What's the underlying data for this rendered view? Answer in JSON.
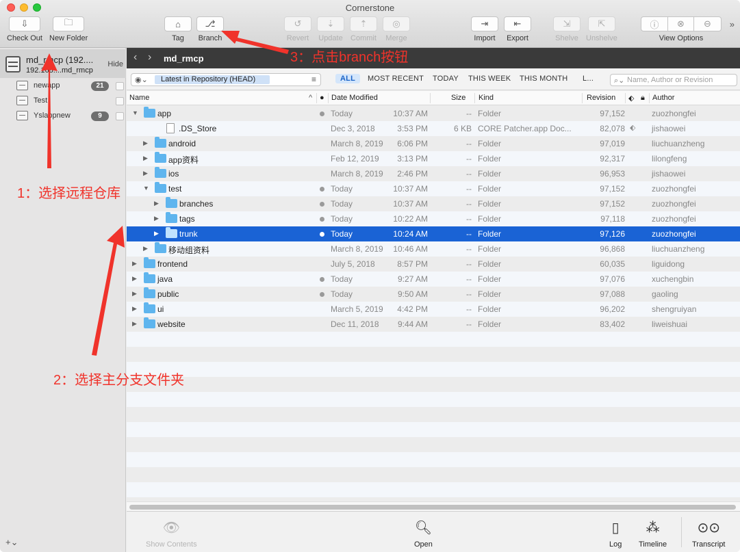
{
  "window": {
    "title": "Cornerstone"
  },
  "toolbar": {
    "check_out": "Check Out",
    "new_folder": "New Folder",
    "tag": "Tag",
    "branch": "Branch",
    "revert": "Revert",
    "update": "Update",
    "commit": "Commit",
    "merge": "Merge",
    "import": "Import",
    "export": "Export",
    "shelve": "Shelve",
    "unshelve": "Unshelve",
    "view_options": "View Options",
    "more": "»"
  },
  "sidebar": {
    "repo": {
      "name": "md_rmcp (192....",
      "host": "192.168....md_rmcp",
      "hide": "Hide"
    },
    "items": [
      {
        "label": "newapp",
        "badge": "21"
      },
      {
        "label": "Test",
        "badge": ""
      },
      {
        "label": "Yslappnew",
        "badge": "9"
      }
    ],
    "add": "+⌄"
  },
  "nav": {
    "back": "‹",
    "forward": "›",
    "title": "md_rmcp"
  },
  "filter": {
    "scope_icon": "eye-icon",
    "scope": "Latest in Repository (HEAD)",
    "tabs": [
      "ALL",
      "MOST RECENT",
      "TODAY",
      "THIS WEEK",
      "THIS MONTH",
      "L..."
    ],
    "active_tab": "ALL",
    "search_placeholder": "Name, Author or Revision"
  },
  "columns": {
    "name": "Name",
    "date_modified": "Date Modified",
    "size": "Size",
    "kind": "Kind",
    "revision": "Revision",
    "author": "Author"
  },
  "rows": [
    {
      "name": "app",
      "disclosure": "▼",
      "indent": 0,
      "type": "folder",
      "dot": true,
      "date": "Today",
      "time": "10:37 AM",
      "size": "--",
      "kind": "Folder",
      "revision": "97,152",
      "author": "zuozhongfei",
      "tag": false,
      "selected": false
    },
    {
      "name": ".DS_Store",
      "disclosure": "",
      "indent": 1,
      "type": "file",
      "dot": false,
      "date": "Dec 3, 2018",
      "time": "3:53 PM",
      "size": "6 KB",
      "kind": "CORE Patcher.app Doc...",
      "revision": "82,078",
      "author": "jishaowei",
      "tag": true,
      "selected": false
    },
    {
      "name": "android",
      "disclosure": "▶",
      "indent": 1,
      "type": "folder",
      "dot": false,
      "date": "March 8, 2019",
      "time": "6:06 PM",
      "size": "--",
      "kind": "Folder",
      "revision": "97,019",
      "author": "liuchuanzheng",
      "tag": false,
      "selected": false
    },
    {
      "name": "app资料",
      "disclosure": "▶",
      "indent": 1,
      "type": "folder",
      "dot": false,
      "date": "Feb 12, 2019",
      "time": "3:13 PM",
      "size": "--",
      "kind": "Folder",
      "revision": "92,317",
      "author": "lilongfeng",
      "tag": false,
      "selected": false
    },
    {
      "name": "ios",
      "disclosure": "▶",
      "indent": 1,
      "type": "folder",
      "dot": false,
      "date": "March 8, 2019",
      "time": "2:46 PM",
      "size": "--",
      "kind": "Folder",
      "revision": "96,953",
      "author": "jishaowei",
      "tag": false,
      "selected": false
    },
    {
      "name": "test",
      "disclosure": "▼",
      "indent": 1,
      "type": "folder",
      "dot": true,
      "date": "Today",
      "time": "10:37 AM",
      "size": "--",
      "kind": "Folder",
      "revision": "97,152",
      "author": "zuozhongfei",
      "tag": false,
      "selected": false
    },
    {
      "name": "branches",
      "disclosure": "▶",
      "indent": 2,
      "type": "folder",
      "dot": true,
      "date": "Today",
      "time": "10:37 AM",
      "size": "--",
      "kind": "Folder",
      "revision": "97,152",
      "author": "zuozhongfei",
      "tag": false,
      "selected": false
    },
    {
      "name": "tags",
      "disclosure": "▶",
      "indent": 2,
      "type": "folder",
      "dot": true,
      "date": "Today",
      "time": "10:22 AM",
      "size": "--",
      "kind": "Folder",
      "revision": "97,118",
      "author": "zuozhongfei",
      "tag": false,
      "selected": false
    },
    {
      "name": "trunk",
      "disclosure": "▶",
      "indent": 2,
      "type": "folder",
      "dot": true,
      "date": "Today",
      "time": "10:24 AM",
      "size": "--",
      "kind": "Folder",
      "revision": "97,126",
      "author": "zuozhongfei",
      "tag": false,
      "selected": true
    },
    {
      "name": "移动组资料",
      "disclosure": "▶",
      "indent": 1,
      "type": "folder",
      "dot": false,
      "date": "March 8, 2019",
      "time": "10:46 AM",
      "size": "--",
      "kind": "Folder",
      "revision": "96,868",
      "author": "liuchuanzheng",
      "tag": false,
      "selected": false
    },
    {
      "name": "frontend",
      "disclosure": "▶",
      "indent": 0,
      "type": "folder",
      "dot": false,
      "date": "July 5, 2018",
      "time": "8:57 PM",
      "size": "--",
      "kind": "Folder",
      "revision": "60,035",
      "author": "liguidong",
      "tag": false,
      "selected": false
    },
    {
      "name": "java",
      "disclosure": "▶",
      "indent": 0,
      "type": "folder",
      "dot": true,
      "date": "Today",
      "time": "9:27 AM",
      "size": "--",
      "kind": "Folder",
      "revision": "97,076",
      "author": "xuchengbin",
      "tag": false,
      "selected": false
    },
    {
      "name": "public",
      "disclosure": "▶",
      "indent": 0,
      "type": "folder",
      "dot": true,
      "date": "Today",
      "time": "9:50 AM",
      "size": "--",
      "kind": "Folder",
      "revision": "97,088",
      "author": "gaoling",
      "tag": false,
      "selected": false
    },
    {
      "name": "ui",
      "disclosure": "▶",
      "indent": 0,
      "type": "folder",
      "dot": false,
      "date": "March 5, 2019",
      "time": "4:42 PM",
      "size": "--",
      "kind": "Folder",
      "revision": "96,202",
      "author": "shengruiyan",
      "tag": false,
      "selected": false
    },
    {
      "name": "website",
      "disclosure": "▶",
      "indent": 0,
      "type": "folder",
      "dot": false,
      "date": "Dec 11, 2018",
      "time": "9:44 AM",
      "size": "--",
      "kind": "Folder",
      "revision": "83,402",
      "author": "liweishuai",
      "tag": false,
      "selected": false
    }
  ],
  "bottom": {
    "show_contents": "Show Contents",
    "open": "Open",
    "log": "Log",
    "timeline": "Timeline",
    "transcript": "Transcript"
  },
  "annotations": {
    "step1": "1：选择远程仓库",
    "step2": "2：选择主分支文件夹",
    "step3": "3：点击branch按钮"
  },
  "colors": {
    "selection": "#1a63d5",
    "annotation": "#f0332b",
    "folder": "#5fb5ee",
    "navbar": "#3a3a3a"
  }
}
